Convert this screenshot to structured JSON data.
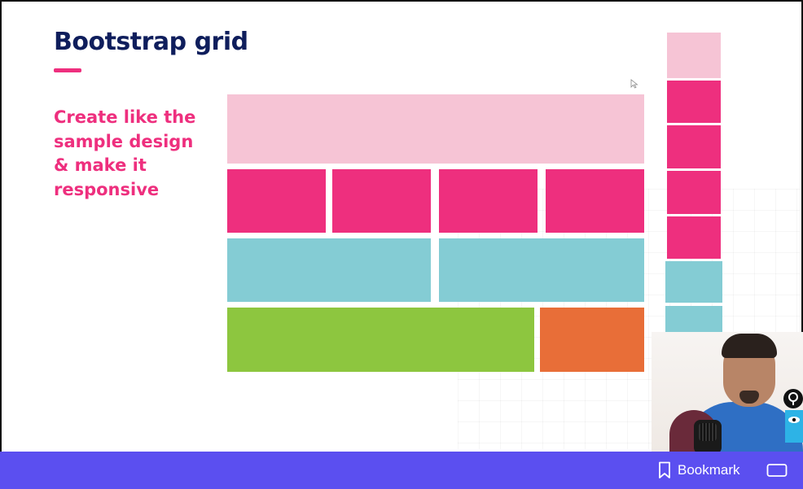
{
  "slide": {
    "title": "Bootstrap grid",
    "instruction_lines": [
      "Create like the",
      "sample design",
      "& make it",
      "responsive"
    ]
  },
  "colors": {
    "title": "#0f1e5c",
    "accent": "#ee2f7e",
    "light_pink": "#f6c4d5",
    "pink": "#ee2f7e",
    "teal": "#84ccd4",
    "green": "#8dc63f",
    "orange": "#e86e38",
    "bottom_bar": "#5b4ff0"
  },
  "bottom_bar": {
    "bookmark_label": "Bookmark",
    "bookmark_icon": "bookmark-icon",
    "screen_icon": "screen-icon"
  }
}
